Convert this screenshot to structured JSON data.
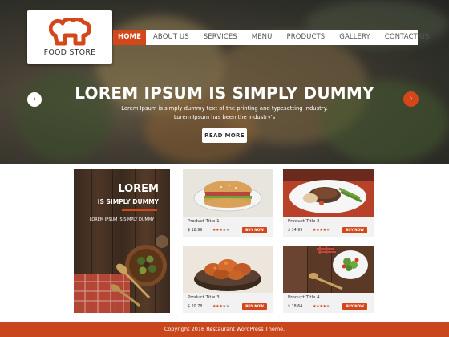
{
  "logo": {
    "text": "FOOD STORE"
  },
  "nav": {
    "items": [
      "HOME",
      "ABOUT US",
      "SERVICES",
      "MENU",
      "PRODUCTS",
      "GALLERY",
      "CONTACT US"
    ],
    "active": "HOME"
  },
  "hero": {
    "title": "LOREM IPSUM IS SIMPLY DUMMY",
    "subtitle": "Lorem Ipsum is simply dummy text of the printing and typesetting industry. Lorem Ipsum has been the industry's",
    "button": "READ MORE",
    "prev_icon": "chevron-left-icon",
    "next_icon": "chevron-right-icon"
  },
  "promo": {
    "title": "LOREM",
    "subtitle": "IS SIMPLY DUMMY",
    "text": "LOREM IPSUM IS SIMPLY DUMMY"
  },
  "products": [
    {
      "title": "Product Title 1",
      "price": "$ 18.99",
      "rating": 4,
      "button": "BUY NOW"
    },
    {
      "title": "Product Title 2",
      "price": "$ 14.99",
      "rating": 4,
      "button": "BUY NOW"
    },
    {
      "title": "Product Title 3",
      "price": "$ 20.78",
      "rating": 4,
      "button": "BUY NOW"
    },
    {
      "title": "Product Title 4",
      "price": "$ 18.64",
      "rating": 4,
      "button": "BUY NOW"
    }
  ],
  "footer": {
    "copyright": "Copyright 2016 Restaurant WordPress Theme."
  },
  "colors": {
    "accent": "#d4471a",
    "footer": "#c9471c",
    "card_bg": "#f2f2f2"
  }
}
